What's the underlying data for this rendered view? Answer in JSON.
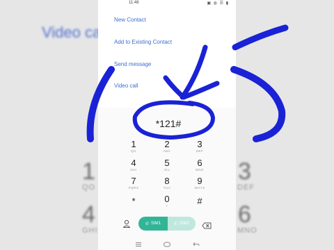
{
  "status": {
    "time": "11:48",
    "icons": "▣ ◍ ☰ ▮"
  },
  "menu": {
    "new_contact": "New Contact",
    "add_existing": "Add to Existing Contact",
    "send_message": "Send message",
    "video_call": "Video call"
  },
  "dialed_number": "*121#",
  "keypad": [
    {
      "digit": "1",
      "letters": "QO"
    },
    {
      "digit": "2",
      "letters": "ABC"
    },
    {
      "digit": "3",
      "letters": "DEF"
    },
    {
      "digit": "4",
      "letters": "GHI"
    },
    {
      "digit": "5",
      "letters": "JKL"
    },
    {
      "digit": "6",
      "letters": "MNO"
    },
    {
      "digit": "7",
      "letters": "PQRS"
    },
    {
      "digit": "8",
      "letters": "TUV"
    },
    {
      "digit": "9",
      "letters": "WXYZ"
    },
    {
      "digit": "*",
      "letters": ""
    },
    {
      "digit": "0",
      "letters": "+"
    },
    {
      "digit": "#",
      "letters": ""
    }
  ],
  "call_buttons": {
    "sim1": "SIM1",
    "sim2": "SIM2"
  },
  "backdrop": {
    "left_title": "Video call",
    "left_digits": [
      "1",
      "4"
    ],
    "left_letters": [
      "QO",
      "GHI"
    ],
    "right_digits": [
      "3",
      "6"
    ],
    "right_letters": [
      "DEF",
      "MNO"
    ]
  },
  "colors": {
    "accent": "#3d6fd0",
    "call_green": "#31b596",
    "annotation_blue": "#1a22d6"
  }
}
